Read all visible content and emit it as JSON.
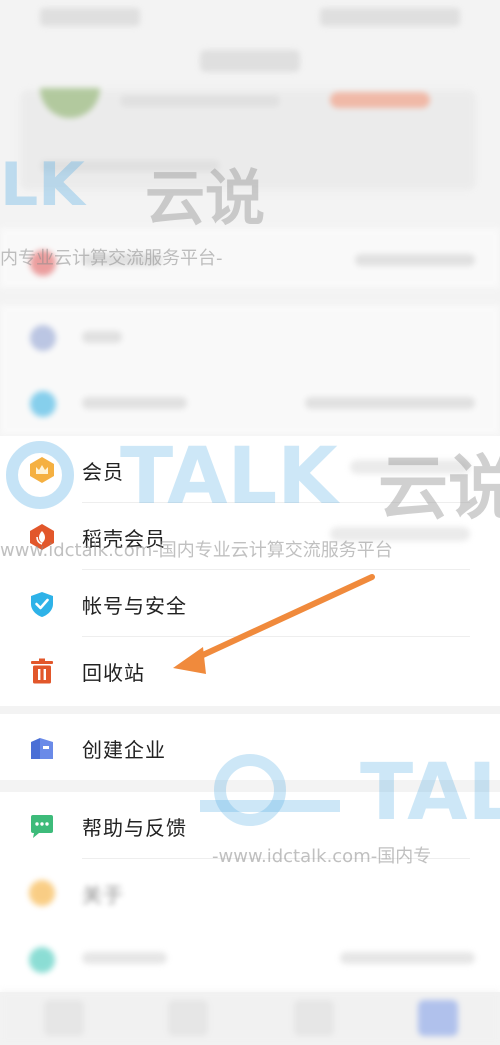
{
  "menu": {
    "vip_label": "会员",
    "daoke_label": "稻壳会员",
    "account_label": "帐号与安全",
    "recycle_label": "回收站",
    "enterprise_label": "创建企业",
    "help_label": "帮助与反馈",
    "about_label": "关于"
  },
  "watermark": {
    "brand_lk": "LK",
    "brand_talk": "TALK",
    "brand_cn": "云说",
    "slogan_short": "内专业云计算交流服务平台-",
    "slogan_long": "www.idctalk.com-国内专业云计算交流服务平台",
    "slogan_bottom": "-www.idctalk.com-国内专"
  },
  "colors": {
    "accent_arrow": "#f08a3c",
    "vip_icon": "#f5a623",
    "daoke_icon": "#e2572b",
    "account_icon": "#2eb2e8",
    "recycle_icon": "#e2572b",
    "enterprise_icon": "#4a6fd6",
    "help_icon": "#3dbb7a",
    "about_icon": "#f5a623"
  }
}
